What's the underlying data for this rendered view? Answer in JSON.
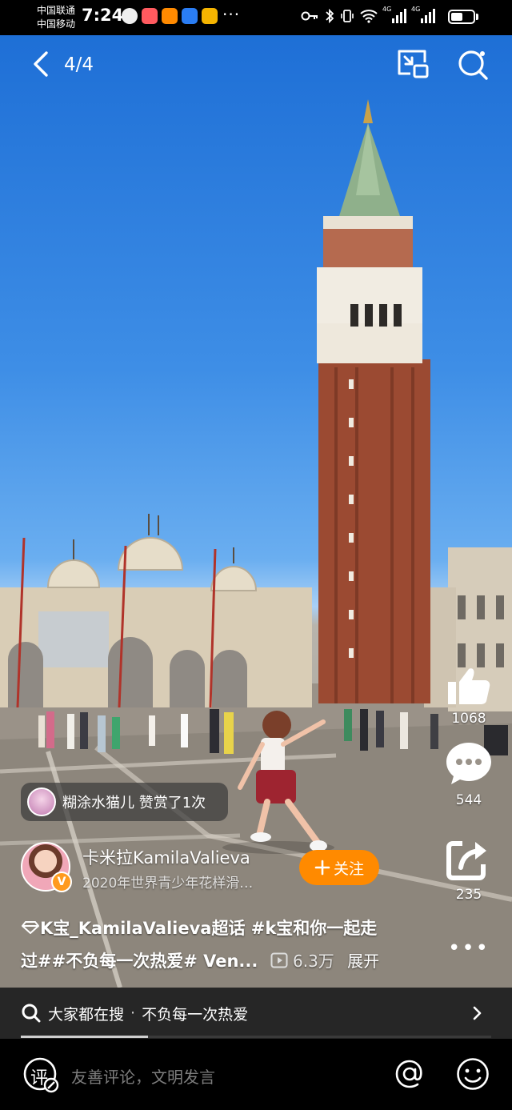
{
  "status_bar": {
    "carrier_1": "中国联通",
    "carrier_2": "中国移动",
    "time": "7:24",
    "more": "···",
    "network_1": "4G",
    "network_2": "4G"
  },
  "top_bar": {
    "page_indicator": "4/4",
    "icons": [
      "back-arrow-icon",
      "picture-in-picture-icon",
      "search-icon"
    ]
  },
  "right_rail": {
    "like_count": "1068",
    "comment_count": "544",
    "share_count": "235",
    "more": "•••"
  },
  "tip_banner": {
    "text": "糊涂水猫儿 赞赏了1次"
  },
  "author": {
    "name": "卡米拉KamilaValieva",
    "subtitle": "2020年世界青少年花样滑…",
    "verified_badge": "V",
    "follow_label": "关注",
    "follow_color": "#ff8a00"
  },
  "caption": {
    "line_1": "K宝_KamilaValieva超话 #k宝和你一起走",
    "line_2": "过##不负每一次热爱# Ven...",
    "views": "6.3万",
    "expand": "展开"
  },
  "hot_search": {
    "prefix": "大家都在搜",
    "separator": "·",
    "term": "不负每一次热爱"
  },
  "progress": {
    "fraction": 0.27
  },
  "comment_bar": {
    "placeholder": "友善评论，文明发言",
    "icon_label": "评"
  }
}
